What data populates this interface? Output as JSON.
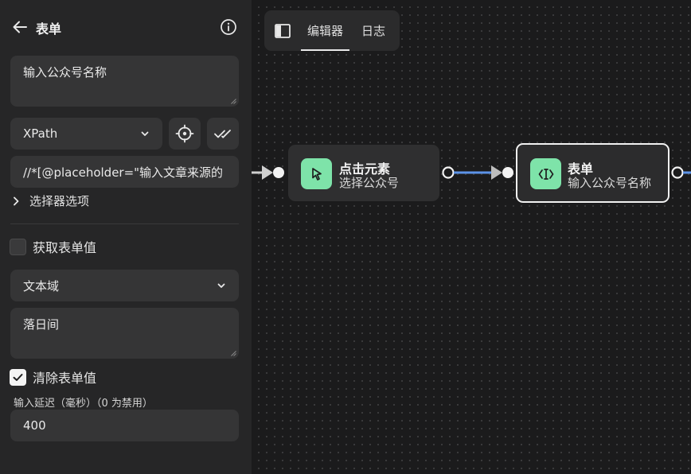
{
  "sidebar": {
    "title": "表单",
    "text_input_value": "输入公众号名称",
    "selector_type": "XPath",
    "xpath_value": "//*[@placeholder=\"输入文章来源的",
    "selector_options_label": "选择器选项",
    "get_form_value_label": "获取表单值",
    "get_form_value_checked": false,
    "field_type": "文本域",
    "form_value": "落日间",
    "clear_form_value_label": "清除表单值",
    "clear_form_value_checked": true,
    "delay_label": "输入延迟（毫秒）（0 为禁用）",
    "delay_value": "400"
  },
  "tabs": [
    {
      "label": "编辑器",
      "active": true
    },
    {
      "label": "日志",
      "active": false
    }
  ],
  "nodes": [
    {
      "title": "点击元素",
      "subtitle": "选择公众号",
      "icon": "cursor-click-icon"
    },
    {
      "title": "表单",
      "subtitle": "输入公众号名称",
      "icon": "text-cursor-input-icon",
      "selected": true
    }
  ],
  "colors": {
    "sidebar_bg": "#262627",
    "field_bg": "#353536",
    "canvas_bg": "#1b1b1c",
    "node_icon_bg": "#7ee3a9",
    "edge_active": "#5c93e8",
    "edge_default": "#cfcfcf"
  }
}
